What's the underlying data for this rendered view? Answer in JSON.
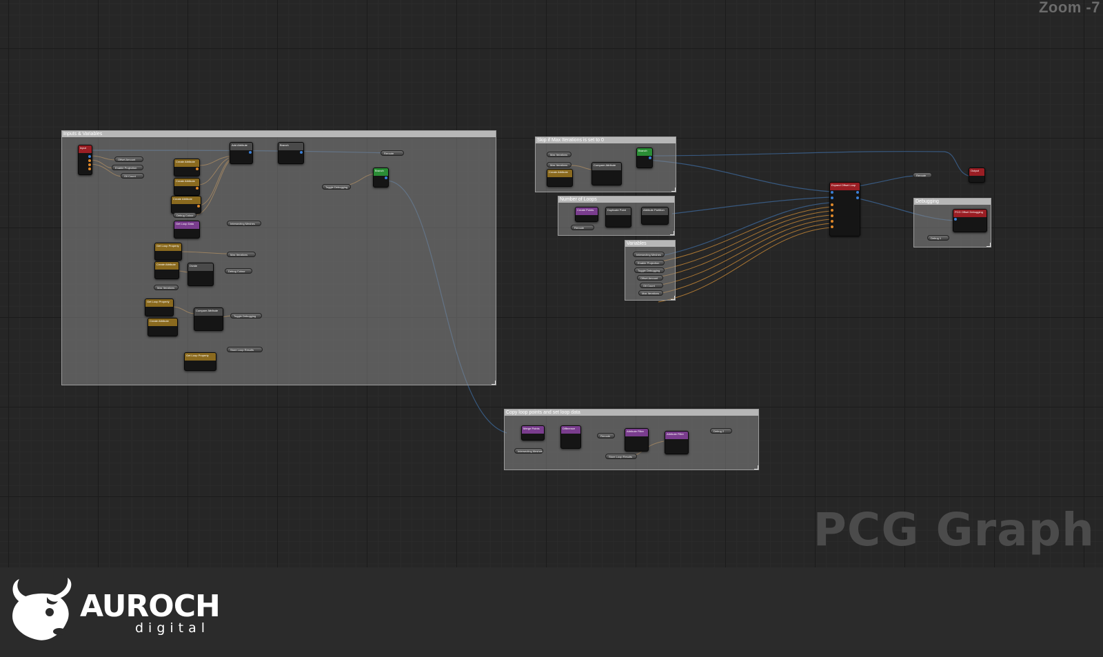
{
  "overlay": {
    "zoom": "Zoom -7",
    "watermark": "PCG Graph"
  },
  "brand": {
    "name": "AUROCH",
    "sub": "digital"
  },
  "colors": {
    "orange": "#e0892a",
    "blue": "#3b7fd6",
    "wire": "#3a5f8a",
    "red": "#9a1e24",
    "green": "#2a8d35",
    "purple": "#7a3d8e",
    "gold": "#8a6a1f",
    "grey": "#4a4a4a"
  },
  "comments": [
    {
      "id": "main",
      "title": "Inputs & Variables"
    },
    {
      "id": "skip",
      "title": "Skip if Max Iterations is set to 0"
    },
    {
      "id": "loops",
      "title": "Number of Loops"
    },
    {
      "id": "vars",
      "title": "Variables"
    },
    {
      "id": "debug",
      "title": "Debugging"
    },
    {
      "id": "copy",
      "title": "Copy loop points and set loop data"
    }
  ],
  "nodes": [
    {
      "label": "Input"
    },
    {
      "label": "Create Attribute"
    },
    {
      "label": "Create Attribute"
    },
    {
      "label": "Create Attribute"
    },
    {
      "label": "Get Loop Data"
    },
    {
      "label": "Add Attribute"
    },
    {
      "label": "Branch"
    },
    {
      "label": "Branch"
    },
    {
      "label": "Get Loop Property"
    },
    {
      "label": "Create Attribute"
    },
    {
      "label": "Divide"
    },
    {
      "label": "Get Loop Property"
    },
    {
      "label": "Create Attribute"
    },
    {
      "label": "Compare Attribute"
    },
    {
      "label": "Get Loop Property"
    },
    {
      "label": "Create Attribute"
    },
    {
      "label": "Compare Attribute"
    },
    {
      "label": "Branch"
    },
    {
      "label": "Create Points"
    },
    {
      "label": "Duplicate Point"
    },
    {
      "label": "Attribute Partition"
    },
    {
      "label": "Expand Offset Loop"
    },
    {
      "label": "Output"
    },
    {
      "label": "PCG Offset Debugging"
    },
    {
      "label": "Merge Points"
    },
    {
      "label": "Difference"
    },
    {
      "label": "Attribute Filter"
    },
    {
      "label": "Attribute Filter"
    }
  ],
  "reroutes": [
    {
      "label": "Offset Amount"
    },
    {
      "label": "Enable Projection"
    },
    {
      "label": "Oil Count"
    },
    {
      "label": "Debug Colour"
    },
    {
      "label": "Toggle Debugging"
    },
    {
      "label": "Intersecting Meshes"
    },
    {
      "label": "Max Iterations"
    },
    {
      "label": "Debug Colour"
    },
    {
      "label": "Max Iterations"
    },
    {
      "label": "Toggle Debugging"
    },
    {
      "label": "Store Loop Results"
    },
    {
      "label": "Reroute"
    },
    {
      "label": "Max Iterations"
    },
    {
      "label": "Max Iterations"
    },
    {
      "label": "Intersecting Meshes"
    },
    {
      "label": "Enable Projection"
    },
    {
      "label": "Toggle Debugging"
    },
    {
      "label": "Offset Amount"
    },
    {
      "label": "Oil Count"
    },
    {
      "label": "Max Iterations"
    },
    {
      "label": "Reroute"
    },
    {
      "label": "Debug 1"
    },
    {
      "label": "Intersecting Meshes"
    },
    {
      "label": "Reroute"
    },
    {
      "label": "Store Loop Results"
    },
    {
      "label": "Debug 2"
    },
    {
      "label": "Reroute"
    }
  ]
}
